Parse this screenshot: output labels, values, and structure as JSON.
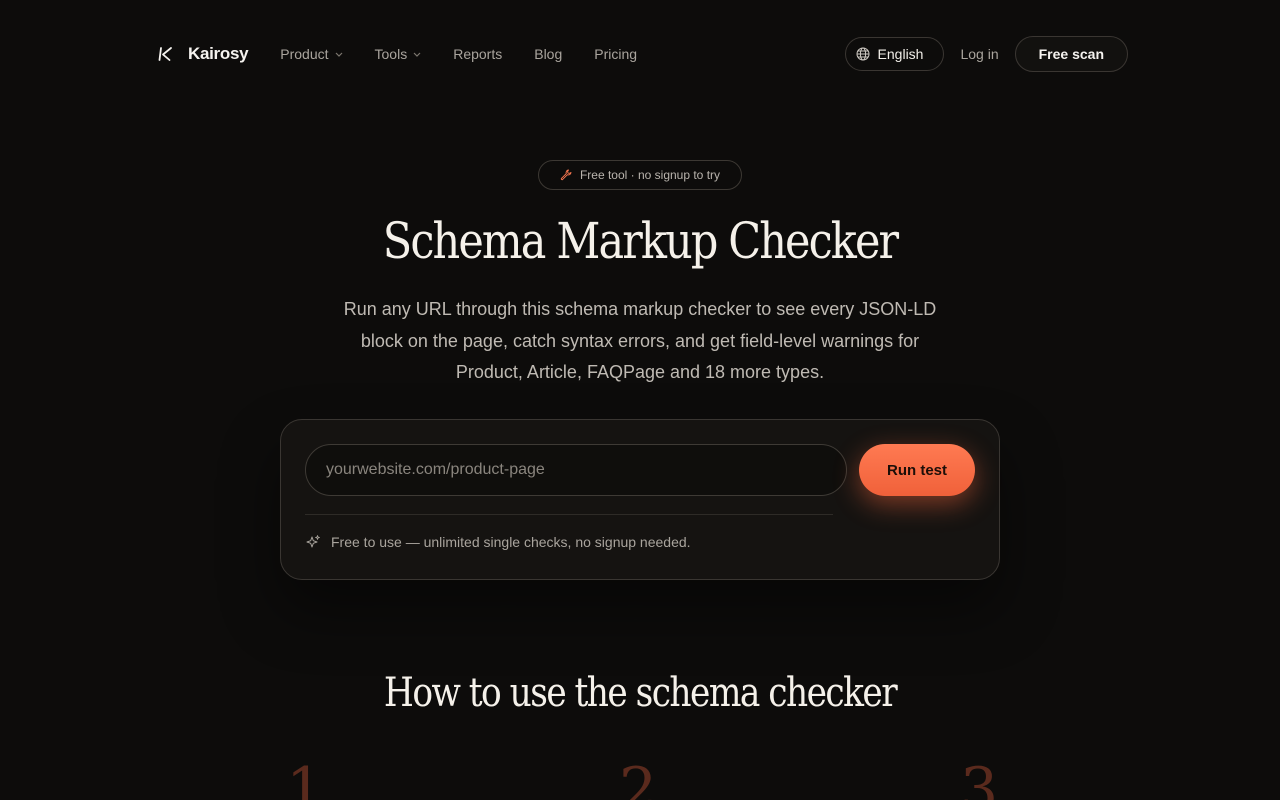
{
  "brand": {
    "name": "Kairosy"
  },
  "nav": {
    "links": [
      {
        "label": "Product",
        "has_dropdown": true
      },
      {
        "label": "Tools",
        "has_dropdown": true
      },
      {
        "label": "Reports",
        "has_dropdown": false
      },
      {
        "label": "Blog",
        "has_dropdown": false
      },
      {
        "label": "Pricing",
        "has_dropdown": false
      }
    ],
    "language": "English",
    "login": "Log in",
    "cta": "Free scan"
  },
  "hero": {
    "badge": "Free tool · no signup to try",
    "title": "Schema Markup Checker",
    "description": "Run any URL through this schema markup checker to see every JSON-LD block on the page, catch syntax errors, and get field-level warnings for Product, Article, FAQPage and 18 more types."
  },
  "checker": {
    "input_value": "",
    "input_placeholder": "yourwebsite.com/product-page",
    "button_label": "Run test",
    "note": "Free to use — unlimited single checks, no signup needed."
  },
  "how_to": {
    "title": "How to use the schema checker",
    "steps": [
      "1",
      "2",
      "3"
    ]
  },
  "colors": {
    "background": "#0d0c0b",
    "accent": "#ff6a3d",
    "step_number": "#5a2a1d"
  },
  "icons": {
    "brand": "kairosy-k-logo",
    "language": "globe-icon",
    "badge": "wrench-icon",
    "note": "sparkle-icon",
    "dropdown": "chevron-down-icon"
  }
}
